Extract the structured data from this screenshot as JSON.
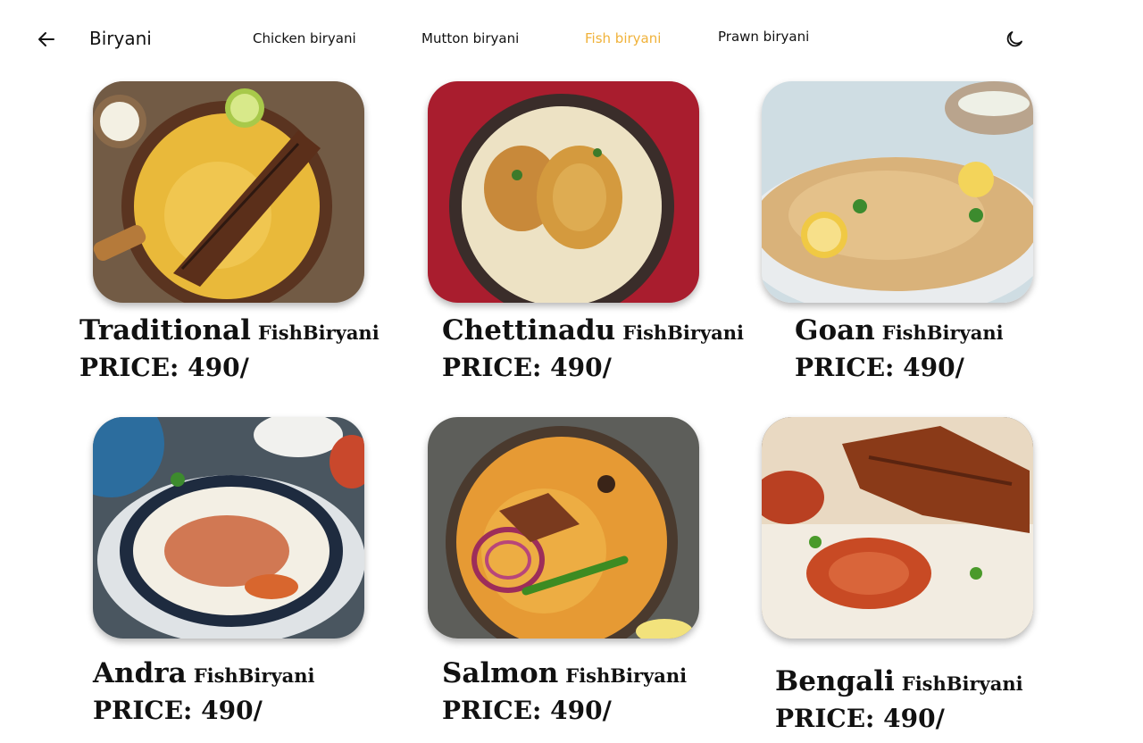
{
  "header": {
    "title": "Biryani",
    "tabs": [
      {
        "label": "Chicken biryani",
        "active": false
      },
      {
        "label": "Mutton biryani",
        "active": false
      },
      {
        "label": "Fish biryani",
        "active": true
      },
      {
        "label": "Prawn biryani",
        "active": false
      }
    ],
    "back_icon": "arrow-left-icon",
    "theme_icon": "moon-icon",
    "accent_color": "#f0b23a"
  },
  "items": [
    {
      "name": "Traditional",
      "suffix": "FishBiryani",
      "price": "PRICE: 490/"
    },
    {
      "name": "Chettinadu",
      "suffix": "FishBiryani",
      "price": "PRICE: 490/"
    },
    {
      "name": "Goan",
      "suffix": "FishBiryani",
      "price": "PRICE: 490/"
    },
    {
      "name": "Andra",
      "suffix": "FishBiryani",
      "price": "PRICE: 490/"
    },
    {
      "name": "Salmon",
      "suffix": "FishBiryani",
      "price": "PRICE: 490/"
    },
    {
      "name": "Bengali",
      "suffix": "FishBiryani",
      "price": "PRICE: 490/"
    }
  ]
}
